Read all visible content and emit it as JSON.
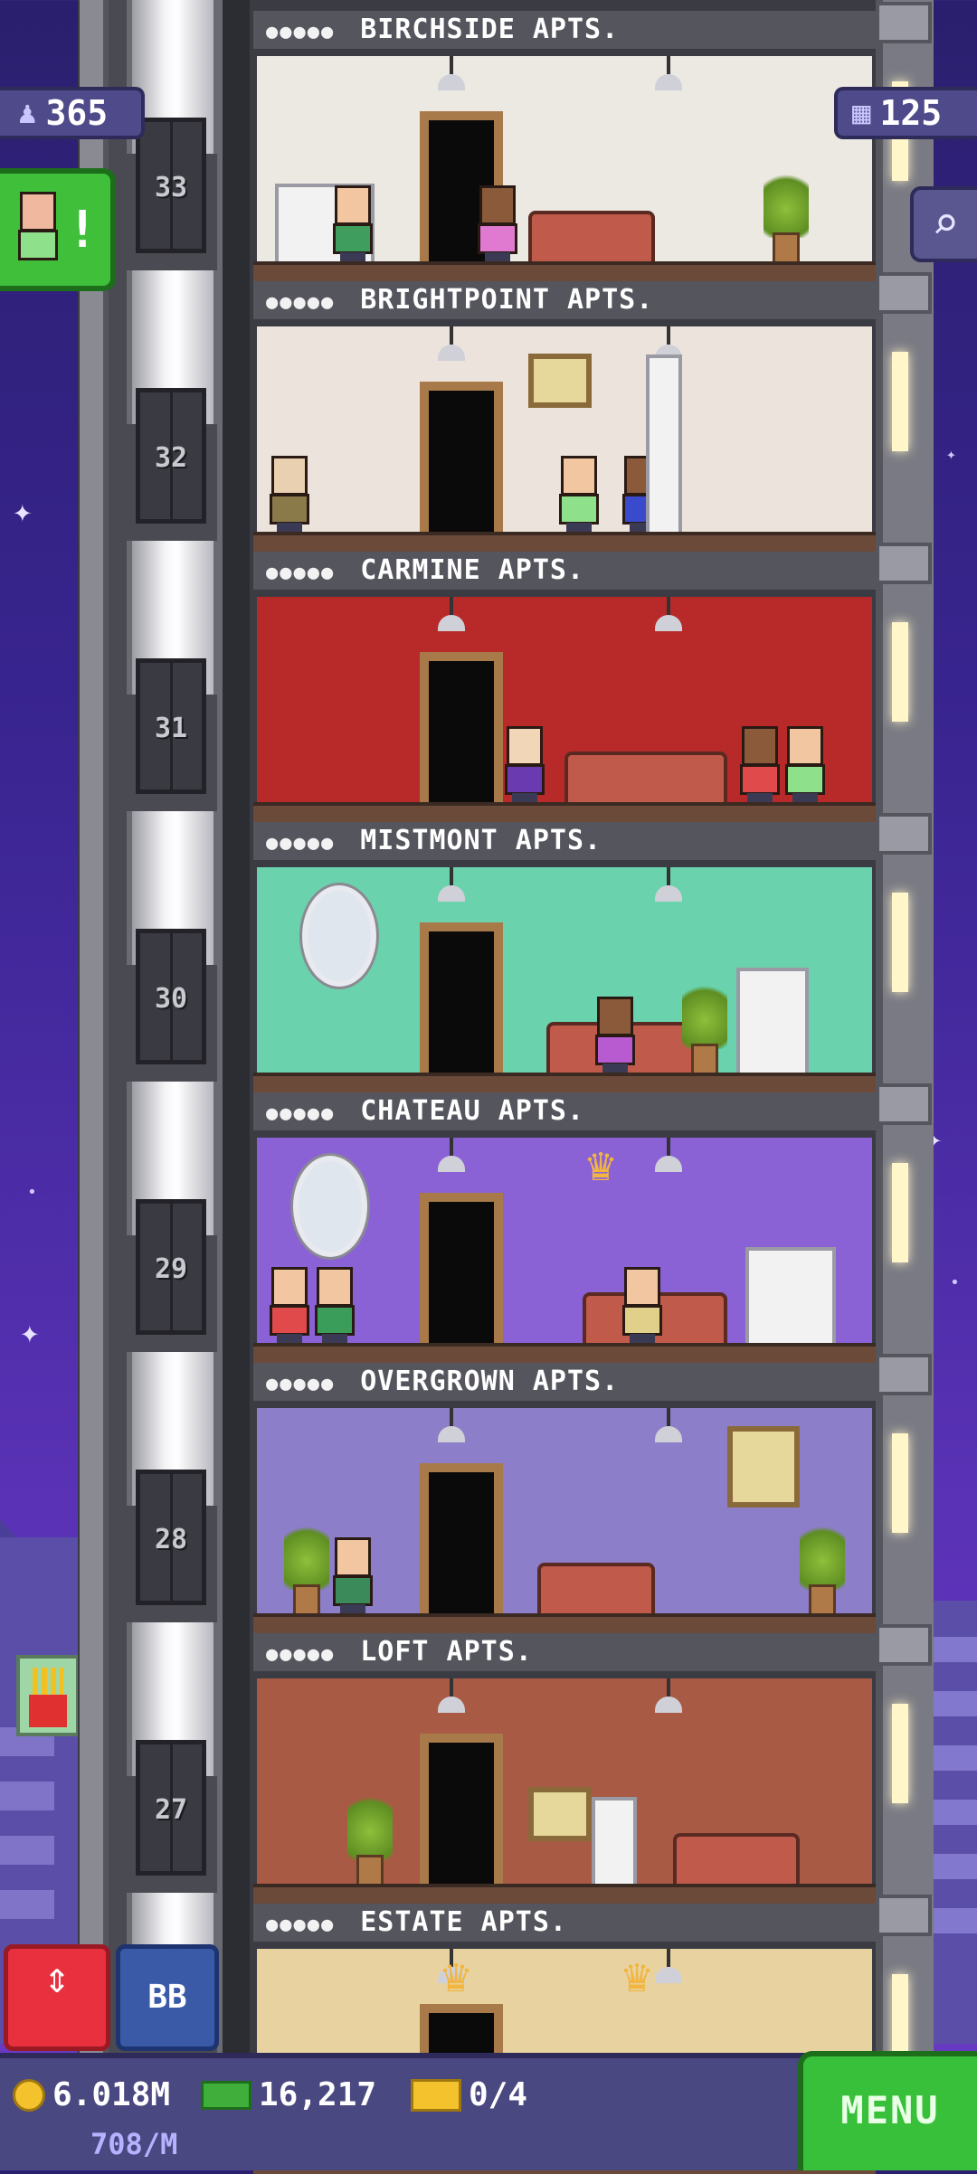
{
  "hud": {
    "population": "365",
    "floors_count": "125",
    "search_icon": "magnifier-icon",
    "mission_alert": "!"
  },
  "floors": [
    {
      "number": "33",
      "name": "BIRCHSIDE APTS.",
      "wall": "#ece8e2"
    },
    {
      "number": "32",
      "name": "BRIGHTPOINT APTS.",
      "wall": "#ece4dc"
    },
    {
      "number": "31",
      "name": "CARMINE APTS.",
      "wall": "#b82a2a"
    },
    {
      "number": "30",
      "name": "MISTMONT APTS.",
      "wall": "#6ad2ad"
    },
    {
      "number": "29",
      "name": "CHATEAU APTS.",
      "wall": "#8a62d6"
    },
    {
      "number": "28",
      "name": "OVERGROWN APTS.",
      "wall": "#8c7ec8"
    },
    {
      "number": "27",
      "name": "LOFT APTS.",
      "wall": "#a85a44"
    },
    {
      "number": "",
      "name": "ESTATE APTS.",
      "wall": "#e8d2a0"
    }
  ],
  "pips": "●●●●●",
  "buttons": {
    "elevator": "⇕",
    "bb": "BB",
    "menu": "MENU"
  },
  "bottom": {
    "coins": "6.018M",
    "bux": "16,217",
    "tickets": "0/4",
    "rate": "708/M"
  },
  "colors": {
    "menu_green": "#39c03a",
    "elevator_red": "#e8303e",
    "bb_blue": "#3a5aa8"
  }
}
